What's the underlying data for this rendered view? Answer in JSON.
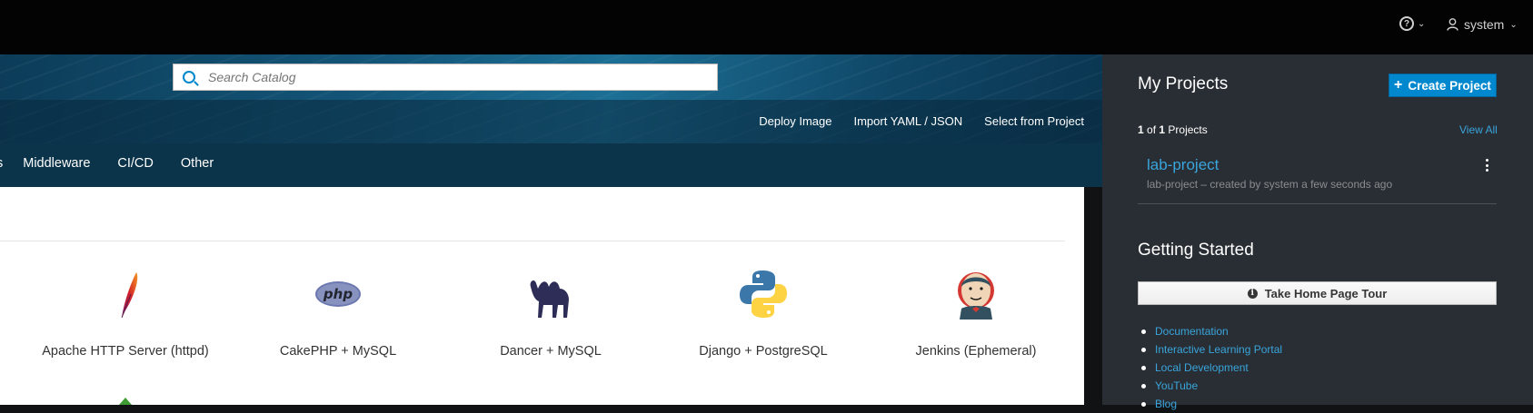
{
  "topbar": {
    "help_chevron": "⌄",
    "user_name": "system"
  },
  "search": {
    "placeholder": "Search Catalog"
  },
  "actions": [
    "Deploy Image",
    "Import YAML / JSON",
    "Select from Project"
  ],
  "categories": [
    "Middleware",
    "CI/CD",
    "Other"
  ],
  "category_fragment": "s",
  "tiles": [
    {
      "label": "Apache HTTP Server (httpd)",
      "icon": "apache-feather-icon"
    },
    {
      "label": "CakePHP + MySQL",
      "icon": "php-icon"
    },
    {
      "label": "Dancer + MySQL",
      "icon": "camel-icon"
    },
    {
      "label": "Django + PostgreSQL",
      "icon": "python-icon"
    },
    {
      "label": "Jenkins (Ephemeral)",
      "icon": "jenkins-icon"
    }
  ],
  "projects": {
    "title": "My Projects",
    "create_label": "Create Project",
    "count_current": "1",
    "count_of": "of",
    "count_total": "1",
    "count_suffix": "Projects",
    "view_all": "View All",
    "items": [
      {
        "name": "lab-project",
        "description": "lab-project – created by system a few seconds ago"
      }
    ]
  },
  "getting_started": {
    "title": "Getting Started",
    "tour_label": "Take Home Page Tour",
    "links": [
      "Documentation",
      "Interactive Learning Portal",
      "Local Development",
      "YouTube",
      "Blog"
    ]
  },
  "colors": {
    "accent": "#0088ce",
    "link": "#39a5dc",
    "sidebar_bg": "#292e34",
    "masthead_bg": "#030303"
  }
}
